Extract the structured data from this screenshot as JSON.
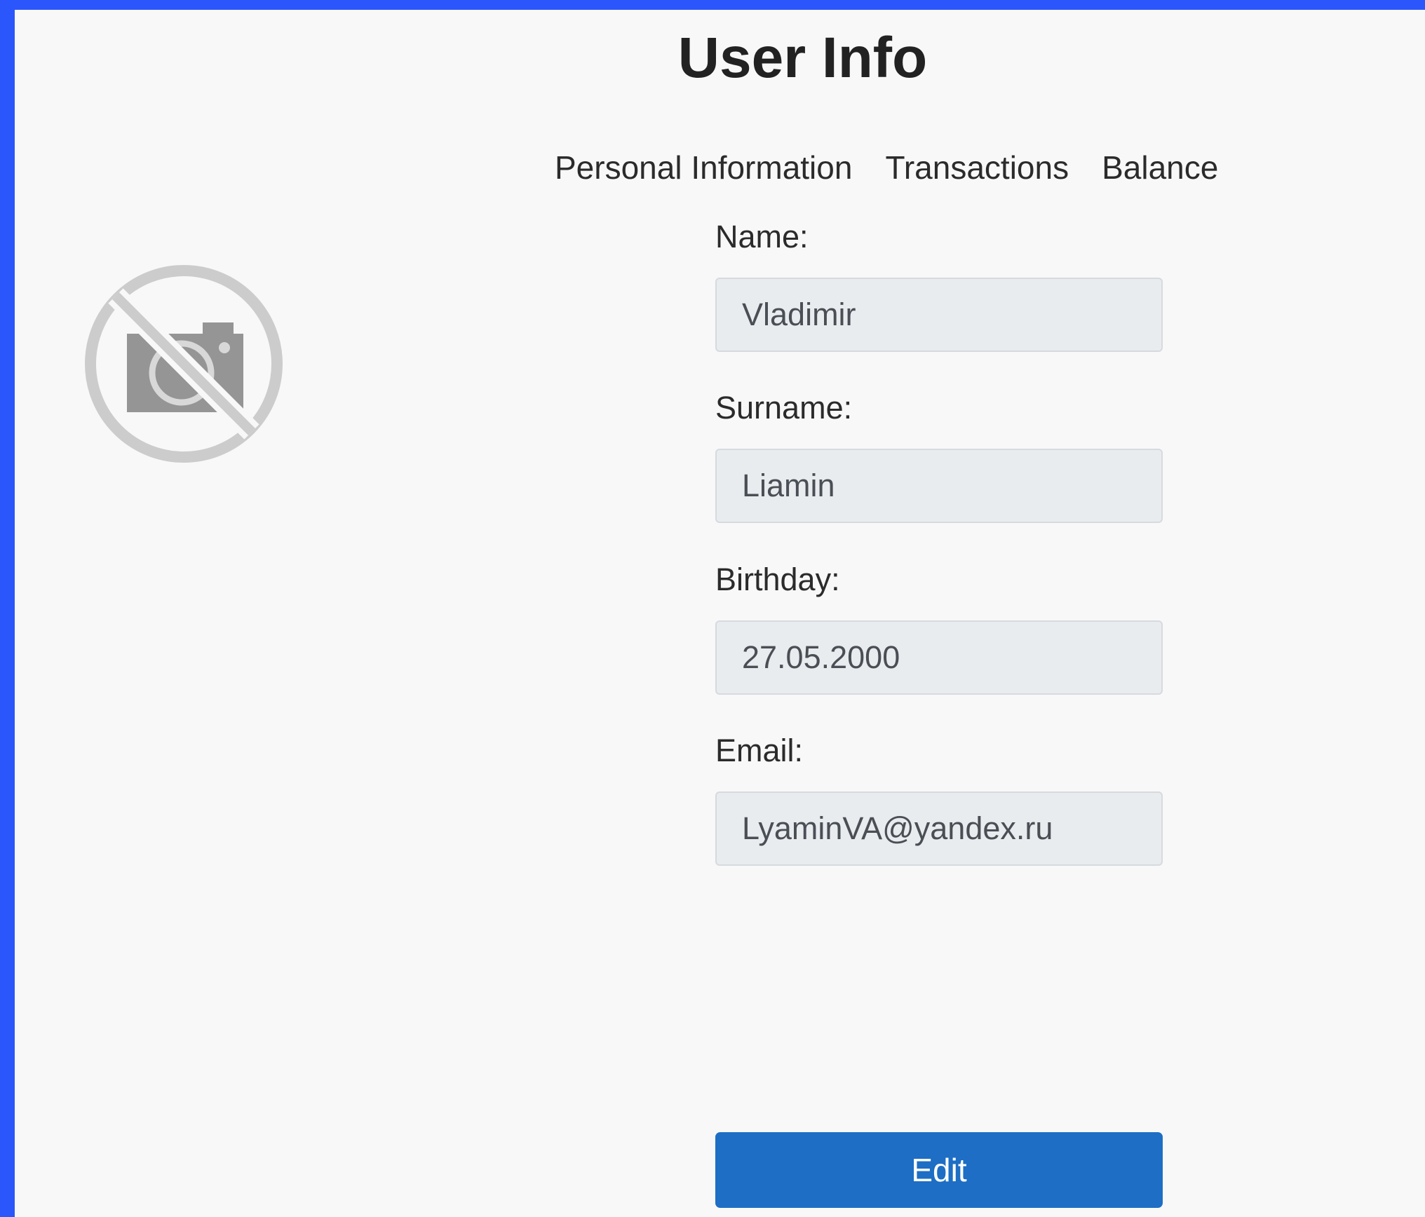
{
  "page": {
    "title": "User Info"
  },
  "tabs": [
    {
      "label": "Personal Information"
    },
    {
      "label": "Transactions"
    },
    {
      "label": "Balance"
    }
  ],
  "avatar": {
    "icon": "no-photo-icon"
  },
  "form": {
    "name": {
      "label": "Name:",
      "value": "Vladimir"
    },
    "surname": {
      "label": "Surname:",
      "value": "Liamin"
    },
    "birthday": {
      "label": "Birthday:",
      "value": "27.05.2000"
    },
    "email": {
      "label": "Email:",
      "value": "LyaminVA@yandex.ru"
    }
  },
  "actions": {
    "edit_label": "Edit"
  },
  "colors": {
    "accent": "#1d6ec4",
    "frame": "#2a56fb",
    "background": "#f8f8f8",
    "input_bg": "#e9ecef"
  }
}
